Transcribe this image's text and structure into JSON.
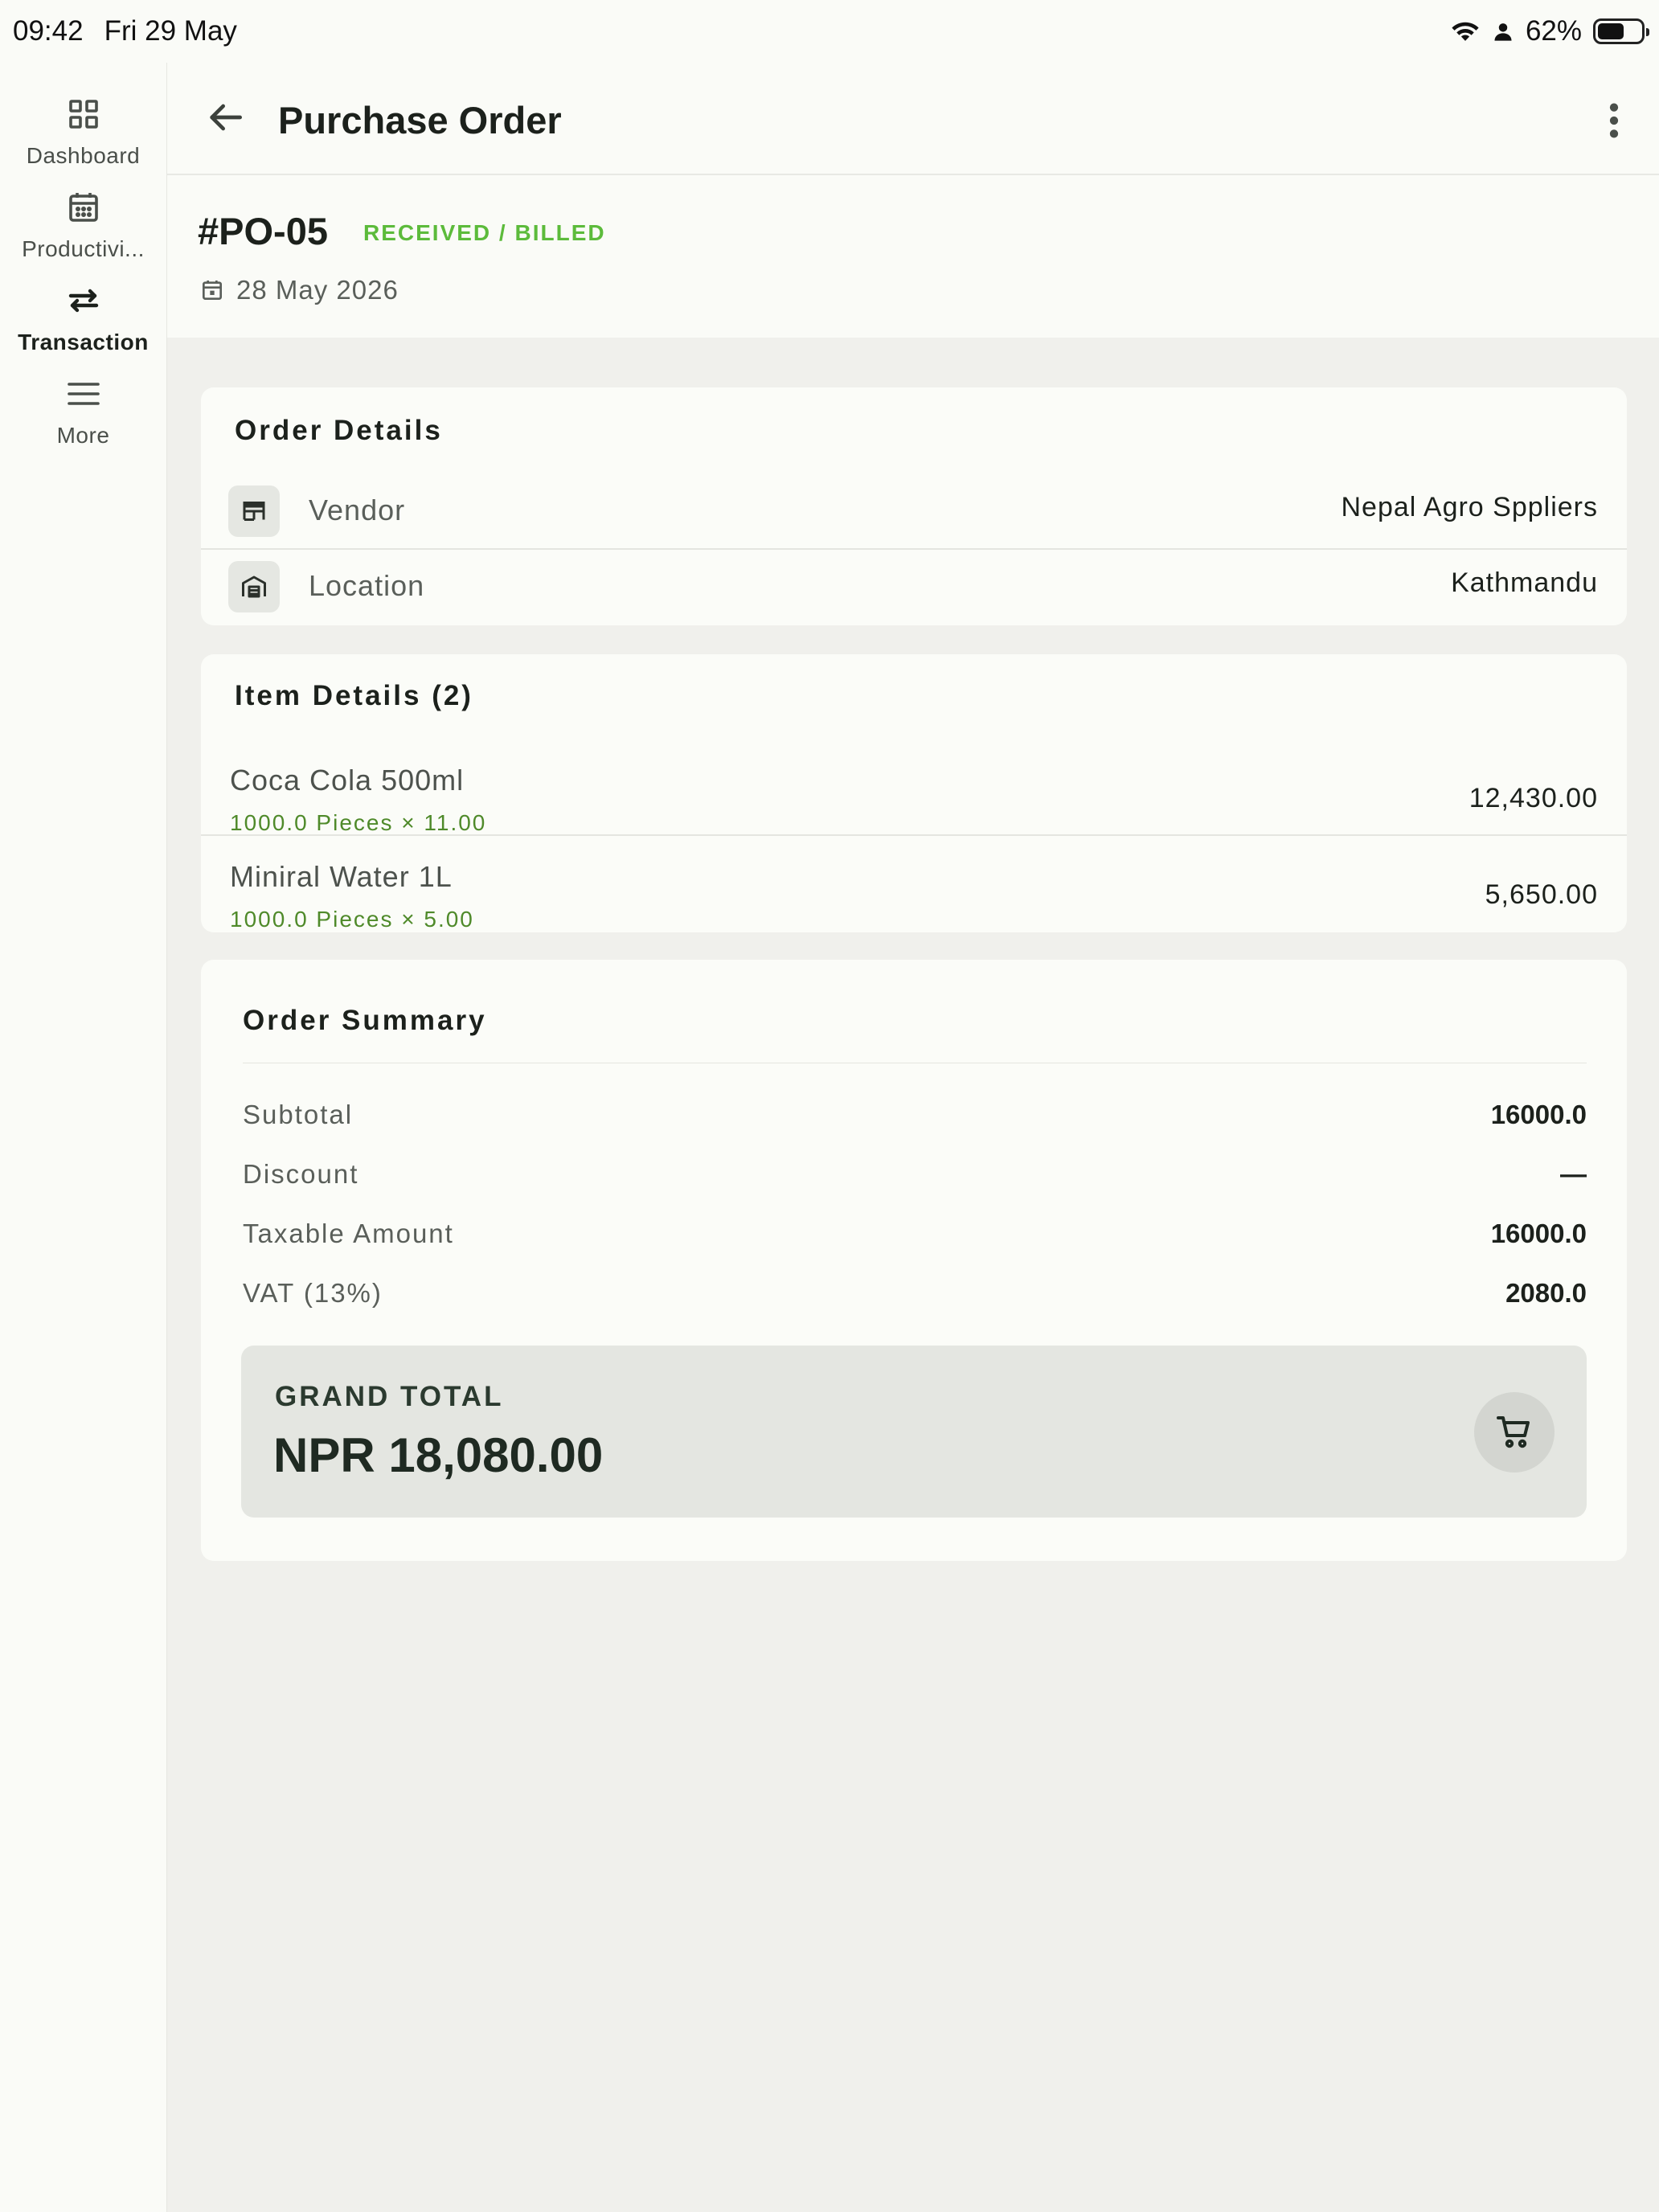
{
  "status_bar": {
    "time": "09:42",
    "date": "Fri 29 May",
    "battery": "62%",
    "battery_level": 0.62
  },
  "rail": {
    "items": [
      {
        "label": "Dashboard",
        "icon": "grid-icon",
        "active": false
      },
      {
        "label": "Productivi...",
        "icon": "calendar-icon",
        "active": false
      },
      {
        "label": "Transaction",
        "icon": "swap-arrows-icon",
        "active": true
      },
      {
        "label": "More",
        "icon": "menu-lines-icon",
        "active": false
      }
    ]
  },
  "header": {
    "title": "Purchase Order",
    "back_icon": "arrow-left-icon",
    "menu_icon": "more-vertical-icon"
  },
  "po": {
    "number": "#PO-05",
    "status": "RECEIVED / BILLED",
    "date": "28 May 2026"
  },
  "order_details": {
    "title": "Order Details",
    "rows": [
      {
        "label": "Vendor",
        "value": "Nepal Agro Sppliers",
        "icon": "store-icon"
      },
      {
        "label": "Location",
        "value": "Kathmandu",
        "icon": "warehouse-icon"
      }
    ]
  },
  "item_details": {
    "title": "Item Details (2)",
    "items": [
      {
        "name": "Coca Cola 500ml",
        "qty": "1000.0 Pieces ×  11.00",
        "amount": "12,430.00"
      },
      {
        "name": "Miniral Water 1L",
        "qty": "1000.0 Pieces ×  5.00",
        "amount": "5,650.00"
      }
    ]
  },
  "order_summary": {
    "title": "Order Summary",
    "rows": [
      {
        "label": "Subtotal",
        "value": "16000.0"
      },
      {
        "label": "Discount",
        "value": "—"
      },
      {
        "label": "Taxable Amount",
        "value": "16000.0"
      },
      {
        "label": "VAT (13%)",
        "value": "2080.0"
      }
    ],
    "grand_total_label": "GRAND TOTAL",
    "grand_total_value": "NPR 18,080.00",
    "cart_icon": "cart-icon"
  },
  "colors": {
    "status_green": "#5cbb3b",
    "qty_green": "#4f8a2a",
    "background": "#f0f0ec",
    "card": "#fbfcf8"
  }
}
